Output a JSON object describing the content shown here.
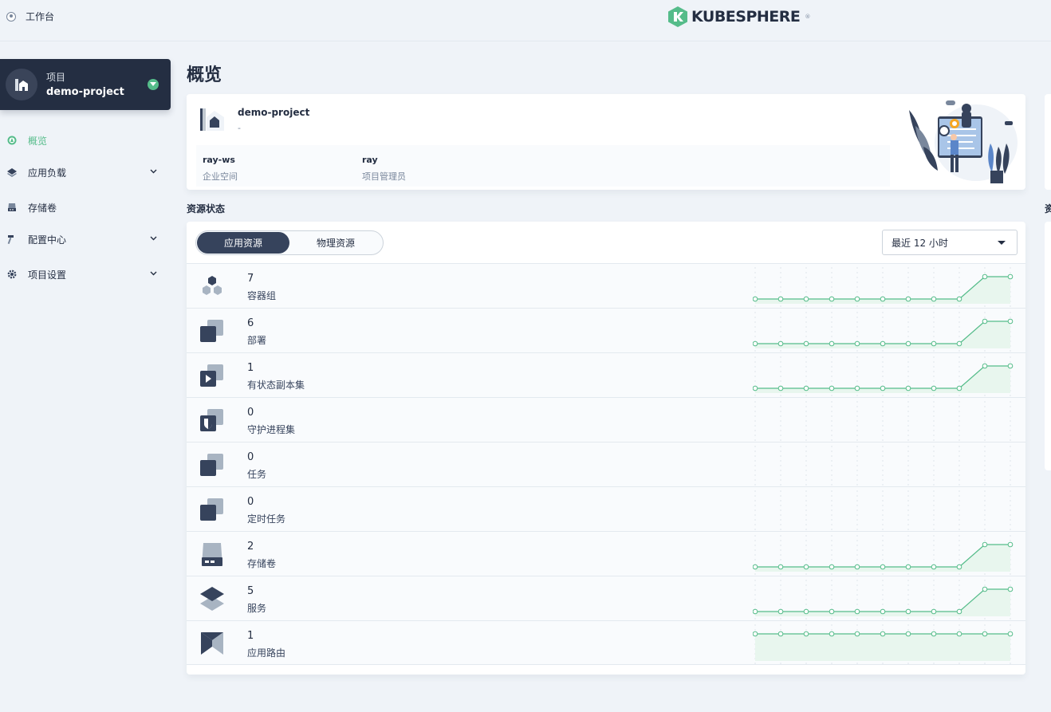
{
  "topbar": {
    "workbench_label": "工作台",
    "brand": "KUBESPHERE",
    "brand_mark": "®"
  },
  "project": {
    "label": "项目",
    "name": "demo-project"
  },
  "nav": [
    {
      "label": "概览",
      "icon": "dashboard-icon",
      "active": true,
      "expandable": false
    },
    {
      "label": "应用负载",
      "icon": "layers-icon",
      "active": false,
      "expandable": true
    },
    {
      "label": "存储卷",
      "icon": "storage-icon",
      "active": false,
      "expandable": false
    },
    {
      "label": "配置中心",
      "icon": "hammer-icon",
      "active": false,
      "expandable": true
    },
    {
      "label": "项目设置",
      "icon": "gear-icon",
      "active": false,
      "expandable": true
    }
  ],
  "page": {
    "title": "概览"
  },
  "info": {
    "project_name": "demo-project",
    "description": "-",
    "workspace_value": "ray-ws",
    "workspace_label": "企业空间",
    "manager_value": "ray",
    "manager_label": "项目管理员"
  },
  "resources": {
    "section_title": "资源状态",
    "side_section_title": "资",
    "tabs": [
      "应用资源",
      "物理资源"
    ],
    "active_tab": 0,
    "time_range": "最近 12 小时",
    "items": [
      {
        "count": "7",
        "name": "容器组",
        "icon": "pods-icon",
        "trend": [
          5,
          5,
          5,
          5,
          5,
          5,
          5,
          5,
          5,
          7,
          7
        ]
      },
      {
        "count": "6",
        "name": "部署",
        "icon": "deployment-icon",
        "trend": [
          5,
          5,
          5,
          5,
          5,
          5,
          5,
          5,
          5,
          6,
          6
        ]
      },
      {
        "count": "1",
        "name": "有状态副本集",
        "icon": "statefulset-icon",
        "trend": [
          0,
          0,
          0,
          0,
          0,
          0,
          0,
          0,
          0,
          1,
          1
        ]
      },
      {
        "count": "0",
        "name": "守护进程集",
        "icon": "daemonset-icon",
        "trend": []
      },
      {
        "count": "0",
        "name": "任务",
        "icon": "job-icon",
        "trend": []
      },
      {
        "count": "0",
        "name": "定时任务",
        "icon": "cronjob-icon",
        "trend": []
      },
      {
        "count": "2",
        "name": "存储卷",
        "icon": "volume-icon",
        "trend": [
          1,
          1,
          1,
          1,
          1,
          1,
          1,
          1,
          1,
          2,
          2
        ]
      },
      {
        "count": "5",
        "name": "服务",
        "icon": "service-icon",
        "trend": [
          4,
          4,
          4,
          4,
          4,
          4,
          4,
          4,
          4,
          5,
          5
        ]
      },
      {
        "count": "1",
        "name": "应用路由",
        "icon": "ingress-icon",
        "trend": [
          1,
          1,
          1,
          1,
          1,
          1,
          1,
          1,
          1,
          1,
          1
        ]
      }
    ]
  },
  "colors": {
    "accent": "#55bc8a",
    "dark": "#242e42",
    "muted": "#79879c",
    "area": "#e8f6ee"
  }
}
